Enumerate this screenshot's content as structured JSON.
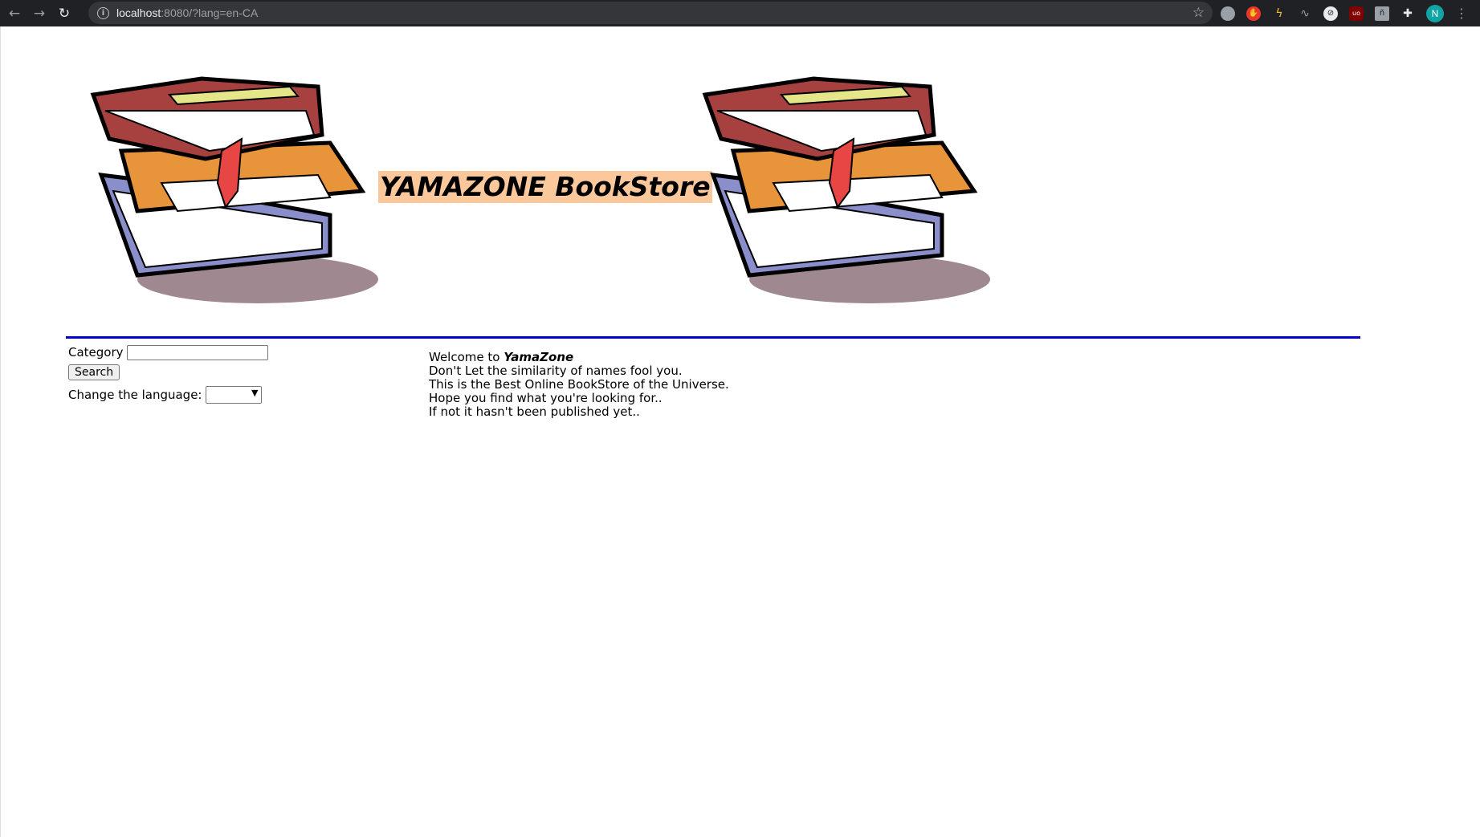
{
  "browser": {
    "url_host": "localhost",
    "url_rest": ":8080/?lang=en-CA",
    "profile_initial": "N",
    "extensions": [
      "globe-icon",
      "stop-hand-icon",
      "bolt-icon",
      "pulse-icon",
      "circle-slash-icon",
      "ublock-icon",
      "translate-icon",
      "puzzle-icon"
    ]
  },
  "header": {
    "title": "YAMAZONE BookStore"
  },
  "sidebar": {
    "category_label": "Category",
    "category_value": "",
    "search_label": "Search",
    "language_label": "Change the language:",
    "language_value": ""
  },
  "welcome": {
    "prefix": "Welcome to ",
    "brand": "YamaZone",
    "line2": "Don't Let the similarity of names fool you.",
    "line3": "This is the Best Online BookStore of the Universe.",
    "line4": "Hope you find what you're looking for..",
    "line5": "If not it hasn't been published yet.."
  },
  "colors": {
    "title_highlight": "#fbc89c",
    "rule": "#0000cc"
  }
}
